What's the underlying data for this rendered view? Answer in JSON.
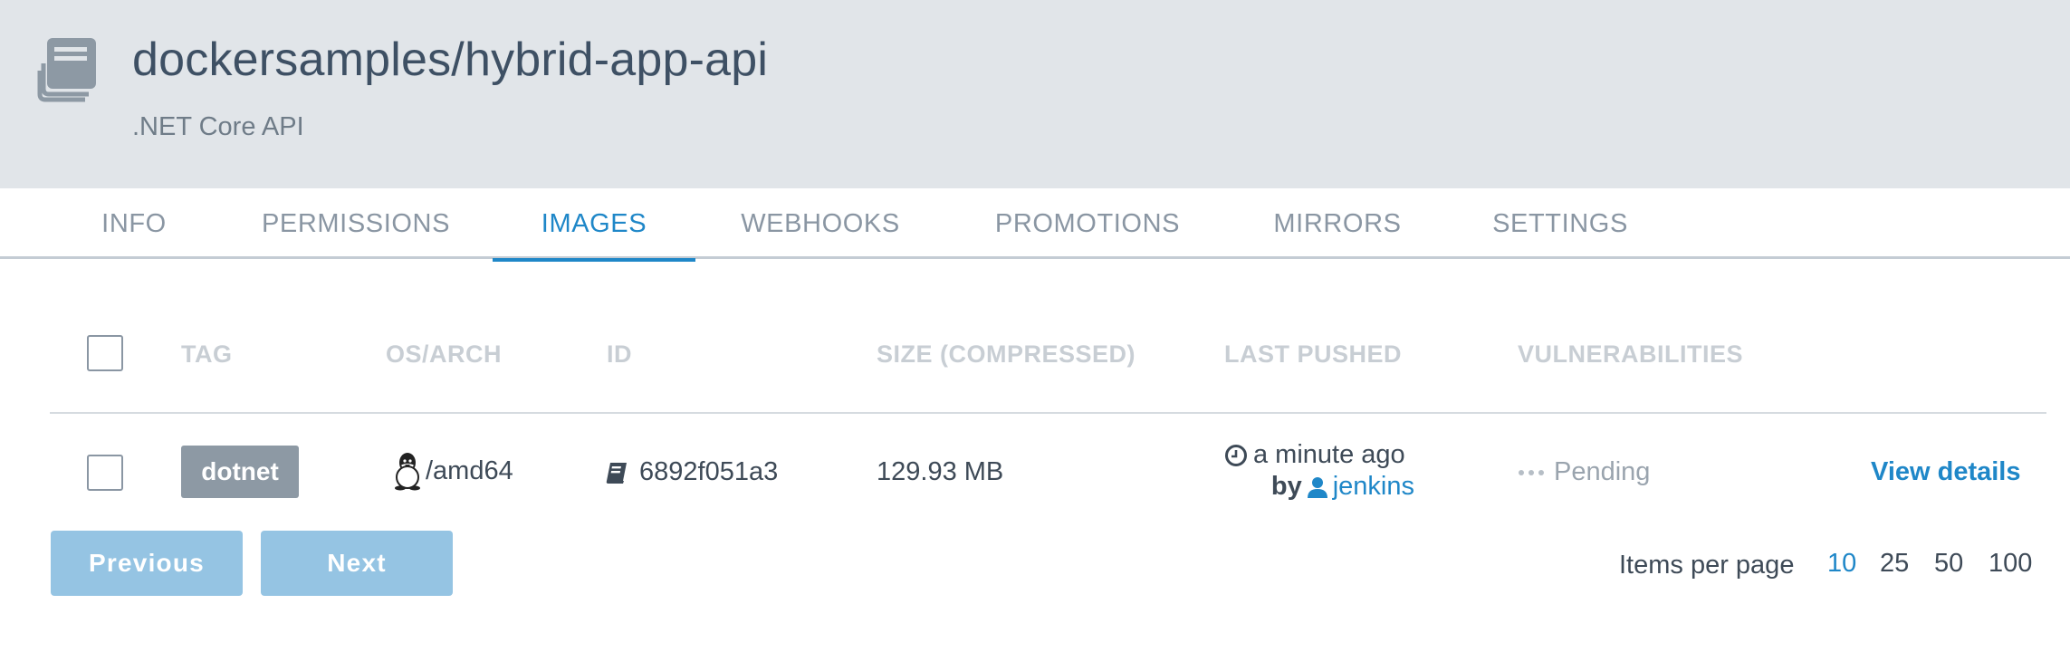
{
  "header": {
    "title": "dockersamples/hybrid-app-api",
    "description": ".NET Core API",
    "icon": "repository-icon"
  },
  "tabs": [
    {
      "label": "INFO",
      "active": false
    },
    {
      "label": "PERMISSIONS",
      "active": false
    },
    {
      "label": "IMAGES",
      "active": true
    },
    {
      "label": "WEBHOOKS",
      "active": false
    },
    {
      "label": "PROMOTIONS",
      "active": false
    },
    {
      "label": "MIRRORS",
      "active": false
    },
    {
      "label": "SETTINGS",
      "active": false
    }
  ],
  "table": {
    "columns": [
      "TAG",
      "OS/ARCH",
      "ID",
      "SIZE (COMPRESSED)",
      "LAST PUSHED",
      "VULNERABILITIES"
    ],
    "rows": [
      {
        "tag": "dotnet",
        "os_icon": "linux-tux-icon",
        "arch": "/amd64",
        "id_icon": "book-icon",
        "id": "6892f051a3",
        "size": "129.93 MB",
        "last_pushed": "a minute ago",
        "by_label": "by",
        "pushed_by": "jenkins",
        "vulnerabilities_icon": "ellipsis-icon",
        "vulnerabilities": "Pending",
        "action": "View details"
      }
    ]
  },
  "pagination": {
    "previous": "Previous",
    "next": "Next",
    "items_per_page_label": "Items per page",
    "options": [
      "10",
      "25",
      "50",
      "100"
    ],
    "selected": "10"
  },
  "colors": {
    "accent": "#1f87c8",
    "header_bg": "#e1e5e9",
    "badge_bg": "#8d99a4",
    "button_disabled": "#95c4e3"
  }
}
